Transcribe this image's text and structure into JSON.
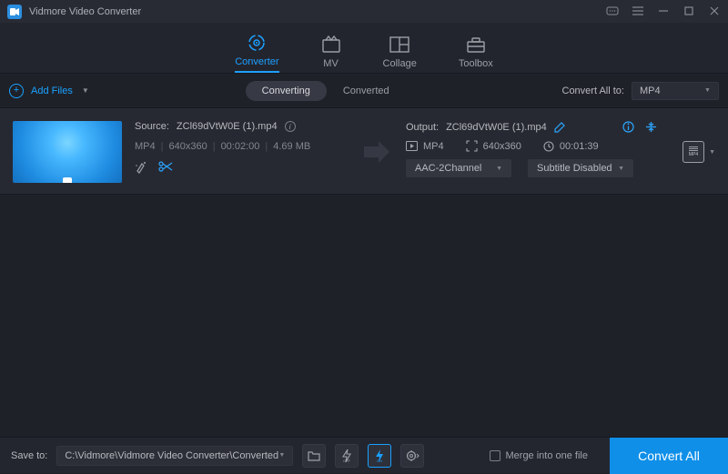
{
  "app": {
    "title": "Vidmore Video Converter"
  },
  "tabs": [
    {
      "label": "Converter",
      "active": true
    },
    {
      "label": "MV"
    },
    {
      "label": "Collage"
    },
    {
      "label": "Toolbox"
    }
  ],
  "toolbar": {
    "add_files": "Add Files",
    "segments": {
      "converting": "Converting",
      "converted": "Converted"
    },
    "convert_all_to_label": "Convert All to:",
    "convert_all_to_value": "MP4"
  },
  "item": {
    "source_label": "Source:",
    "source_name": "ZCl69dVtW0E (1).mp4",
    "format": "MP4",
    "resolution": "640x360",
    "duration": "00:02:00",
    "size": "4.69 MB",
    "output_label": "Output:",
    "output_name": "ZCl69dVtW0E (1).mp4",
    "out_format": "MP4",
    "out_resolution": "640x360",
    "out_duration": "00:01:39",
    "audio_select": "AAC-2Channel",
    "subtitle_select": "Subtitle Disabled",
    "target_badge": "MP4"
  },
  "bottom": {
    "save_to_label": "Save to:",
    "save_path": "C:\\Vidmore\\Vidmore Video Converter\\Converted",
    "merge_label": "Merge into one file",
    "convert_button": "Convert All"
  }
}
